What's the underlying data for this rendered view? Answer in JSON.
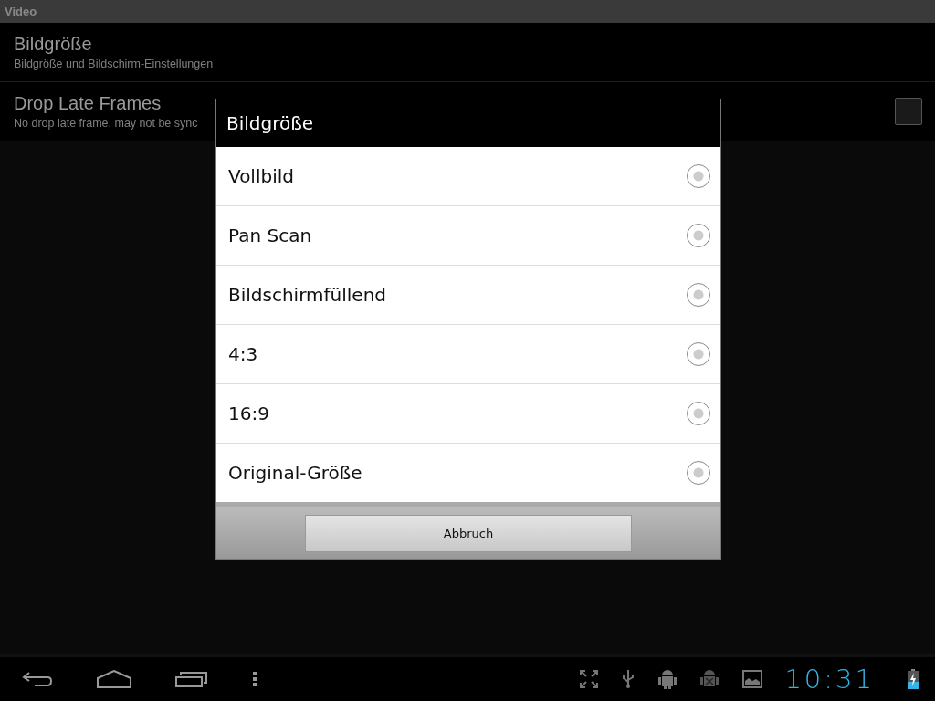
{
  "title_bar": {
    "title": "Video"
  },
  "settings": [
    {
      "kind": "plain",
      "title": "Bildgröße",
      "summary": "Bildgröße und Bildschirm-Einstellungen"
    },
    {
      "kind": "checkbox",
      "title": "Drop Late Frames",
      "summary": "No drop late frame, may not be sync",
      "checked": false
    }
  ],
  "dialog": {
    "title": "Bildgröße",
    "options": [
      {
        "label": "Vollbild",
        "selected": false
      },
      {
        "label": "Pan Scan",
        "selected": false
      },
      {
        "label": "Bildschirmfüllend",
        "selected": false
      },
      {
        "label": "4:3",
        "selected": false
      },
      {
        "label": "16:9",
        "selected": false
      },
      {
        "label": "Original-Größe",
        "selected": false
      }
    ],
    "cancel_button": "Abbruch"
  },
  "status_bar": {
    "clock": "10:31"
  }
}
